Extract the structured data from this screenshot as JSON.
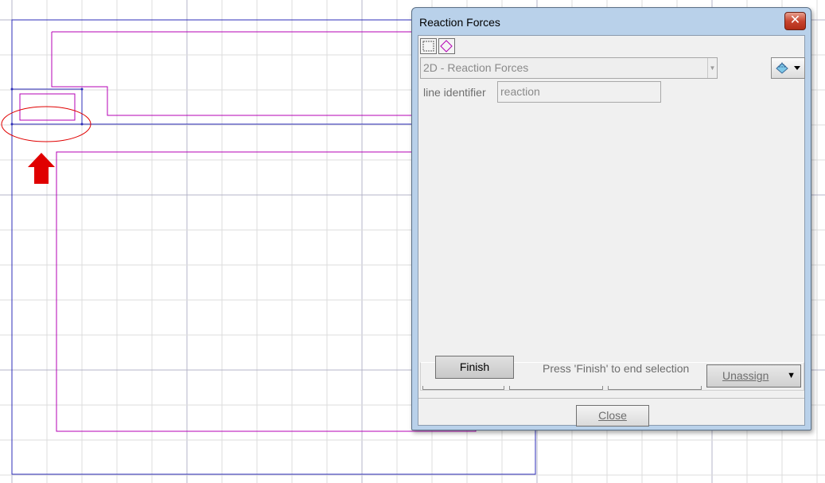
{
  "dialog": {
    "title": "Reaction Forces",
    "close_glyph": "✕",
    "mode_buttons": [
      {
        "icon": "rectangle-select-icon"
      },
      {
        "icon": "polygon-select-icon"
      }
    ],
    "reaction_type": {
      "selected": "2D - Reaction Forces"
    },
    "line_identifier": {
      "label": "line identifier",
      "value": "reaction"
    },
    "finish_label": "Finish",
    "hint": "Press 'Finish' to end selection",
    "unassign_label": "Unassign",
    "close_label": "Close",
    "display_options_icon": "layers-icon"
  },
  "canvas": {
    "colors": {
      "grid_minor": "#dcdcdc",
      "grid_major": "#b4b4c8",
      "boundary": "#2c2cb8",
      "geometry": "#b400b4",
      "highlight": "#e00000"
    },
    "annotation_icon": "arrow-up-icon"
  }
}
